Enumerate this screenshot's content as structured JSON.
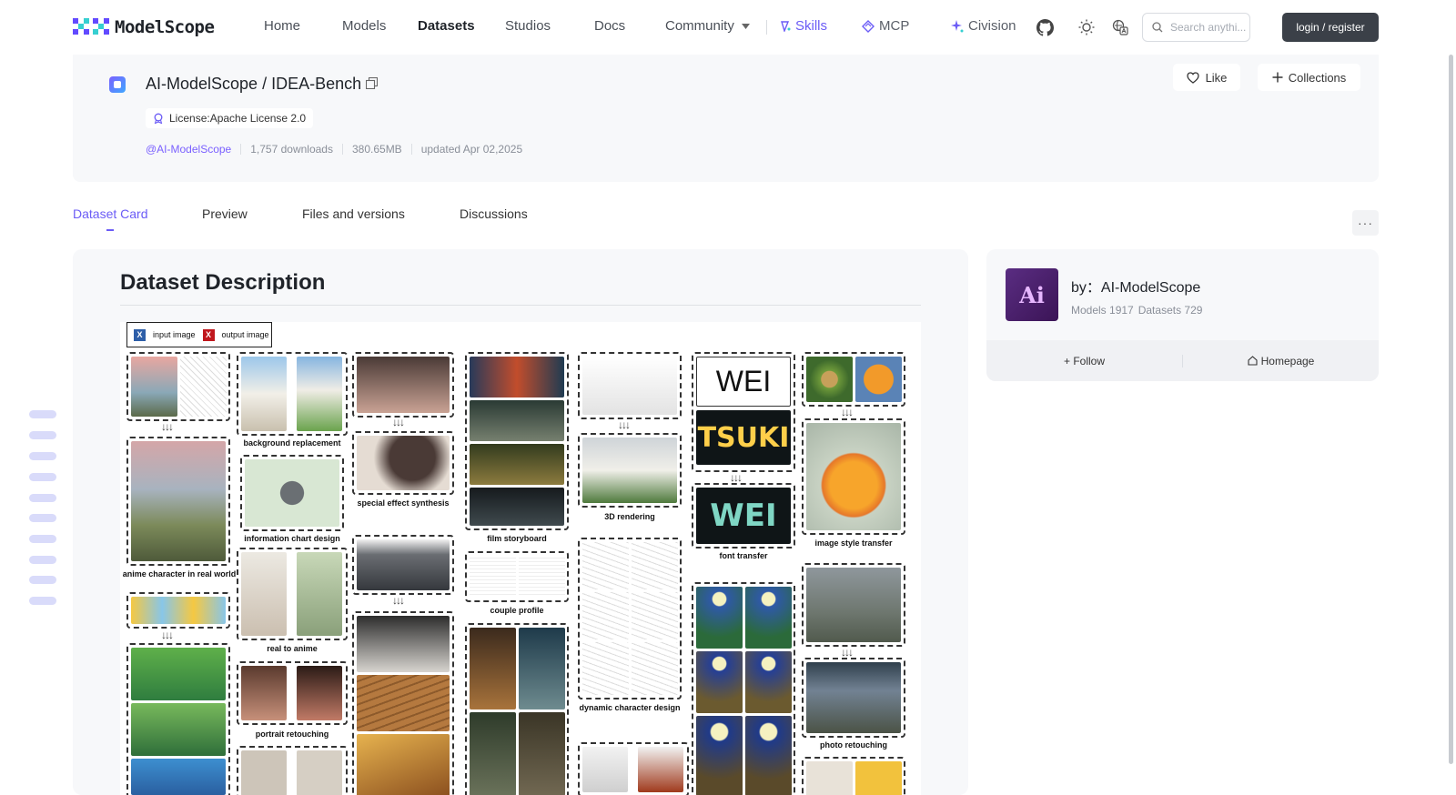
{
  "nav": {
    "logo_text": "ModelScope",
    "items": [
      "Home",
      "Models",
      "Datasets",
      "Studios",
      "Docs",
      "Community"
    ],
    "skills_label": "Skills",
    "mcp_label": "MCP",
    "civision_label": "Civision",
    "search_placeholder": "Search anythi...",
    "login_label": "login / register"
  },
  "header": {
    "owner": "AI-ModelScope",
    "name": "IDEA-Bench",
    "title": "AI-ModelScope / IDEA-Bench",
    "license": "License:Apache License 2.0",
    "org_link": "@AI-ModelScope",
    "downloads": "1,757 downloads",
    "size": "380.65MB",
    "updated": "updated Apr 02,2025",
    "like_label": "Like",
    "collections_label": "Collections"
  },
  "tabs": [
    "Dataset Card",
    "Preview",
    "Files and versions",
    "Discussions"
  ],
  "active_tab": "Dataset Card",
  "more_label": "···",
  "main": {
    "section_title": "Dataset Description",
    "figure": {
      "legend_input": "input image",
      "legend_output": "output image",
      "legend_input_mark": "X",
      "legend_output_mark": "X",
      "captions": {
        "background_replacement": "background replacement",
        "special_effect": "special effect synthesis",
        "film_storyboard": "film storyboard",
        "rendering_3d": "3D rendering",
        "font_transfer": "font transfer",
        "image_style_transfer": "image style transfer",
        "anime_real": "anime character in real world",
        "info_chart": "information chart design",
        "couple_profile": "couple profile",
        "dynamic_character": "dynamic character design",
        "real_to_anime": "real to anime",
        "portrait_retouching": "portrait retouching",
        "photo_retouching": "photo retouching"
      },
      "font_words": [
        "WEI",
        "TSUKI",
        "WEI"
      ]
    }
  },
  "side": {
    "by_label": "by：AI-ModelScope",
    "models_count": "Models 1917",
    "datasets_count": "Datasets 729",
    "avatar_text": "Ai",
    "follow_label": "+ Follow",
    "homepage_label": "Homepage"
  },
  "colors": {
    "accent": "#6b5cf6",
    "brand_dark": "#3b4048",
    "badge_blue": "#2d5ea8",
    "badge_red": "#c0171d"
  }
}
